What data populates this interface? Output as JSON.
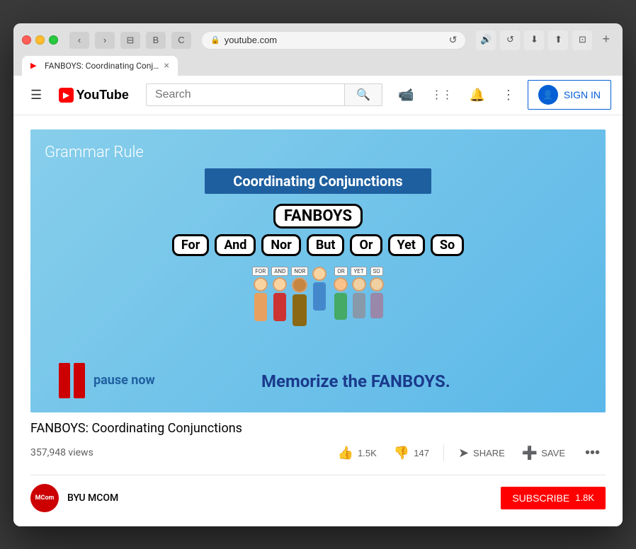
{
  "browser": {
    "tab": {
      "title": "FANBOYS: Coordinating Conjunctions - YouTube",
      "favicon": "▶"
    },
    "address": "youtube.com",
    "lock_icon": "🔒",
    "reload_icon": "↺",
    "nav": {
      "back": "‹",
      "forward": "›",
      "tabs": "⊞",
      "bookmark": "B",
      "refresh_ext": "C"
    },
    "ext_icons": [
      "🔊",
      "↺",
      "⬇",
      "⬆",
      "⊡"
    ],
    "new_tab": "+"
  },
  "youtube": {
    "hamburger": "☰",
    "logo_text": "YouTube",
    "search_placeholder": "Search",
    "search_icon": "🔍",
    "header_icons": {
      "video_camera": "📹",
      "apps": "⋮⋮⋮",
      "notifications": "🔔",
      "more": "⋮"
    },
    "sign_in_label": "SIGN IN",
    "sign_in_icon": "👤"
  },
  "video": {
    "title": "FANBOYS: Coordinating Conjunctions",
    "views": "357,948 views",
    "thumbnail": {
      "grammar_rule": "Grammar Rule",
      "coordinating_title": "Coordinating Conjunctions",
      "fanboys_label": "FANBOYS",
      "fanboys_words": [
        "For",
        "And",
        "Nor",
        "But",
        "Or",
        "Yet",
        "So"
      ],
      "char_signs": [
        "FOR",
        "AND",
        "NOR",
        "OR",
        "YET",
        "SO"
      ],
      "pause_text": "pause now",
      "memorize_text": "Memorize the FANBOYS."
    },
    "actions": {
      "like_count": "1.5K",
      "dislike_count": "147",
      "like_icon": "👍",
      "dislike_icon": "👎",
      "share_label": "SHARE",
      "share_icon": "➤",
      "save_label": "SAVE",
      "save_icon": "➕",
      "more_label": "•••"
    },
    "channel": {
      "name": "BYU MCOM",
      "avatar_text": "MCom",
      "subscribe_label": "SUBSCRIBE",
      "sub_count": "1.8K"
    }
  }
}
